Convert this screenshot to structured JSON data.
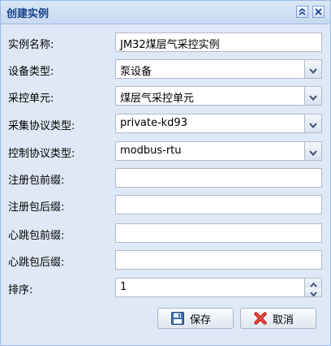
{
  "window": {
    "title": "创建实例",
    "tools": [
      {
        "name": "collapse",
        "icon": "double-chevron-up-icon"
      },
      {
        "name": "close",
        "icon": "close-icon"
      }
    ]
  },
  "form": {
    "fields": [
      {
        "label": "实例名称:",
        "value": "JM32煤层气采控实例",
        "type": "text"
      },
      {
        "label": "设备类型:",
        "value": "泵设备",
        "type": "combo"
      },
      {
        "label": "采控单元:",
        "value": "煤层气采控单元",
        "type": "combo"
      },
      {
        "label": "采集协议类型:",
        "value": "private-kd93",
        "type": "combo"
      },
      {
        "label": "控制协议类型:",
        "value": "modbus-rtu",
        "type": "combo"
      },
      {
        "label": "注册包前缀:",
        "value": "",
        "type": "text"
      },
      {
        "label": "注册包后缀:",
        "value": "",
        "type": "text"
      },
      {
        "label": "心跳包前缀:",
        "value": "",
        "type": "text"
      },
      {
        "label": "心跳包后缀:",
        "value": "",
        "type": "text"
      },
      {
        "label": "排序:",
        "value": "1",
        "type": "number"
      }
    ]
  },
  "buttons": {
    "save_label": "保存",
    "save_icon": "floppy-disk-icon",
    "cancel_label": "取消",
    "cancel_icon": "red-x-icon"
  },
  "colors": {
    "title_text": "#15428b",
    "window_border": "#99bbe8",
    "body_bg": "#dfe8f6",
    "field_border": "#b5b8c8"
  }
}
